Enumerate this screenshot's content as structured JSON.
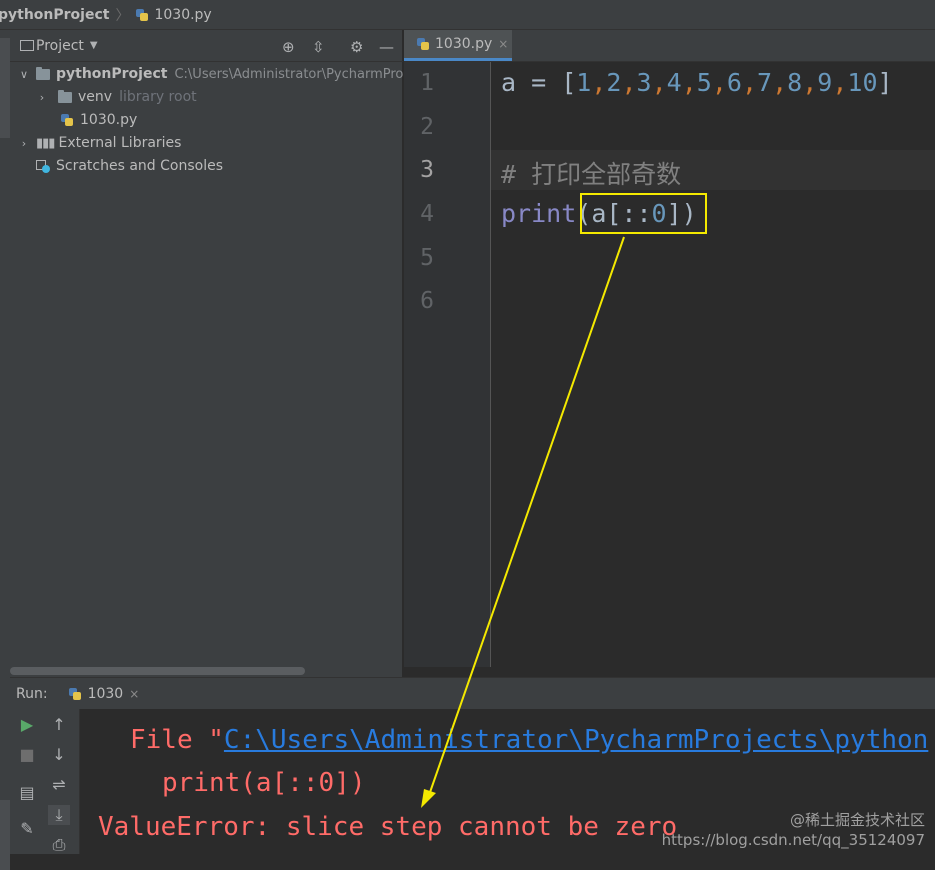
{
  "breadcrumb": {
    "project": "pythonProject",
    "file": "1030.py"
  },
  "project_panel": {
    "title": "Project",
    "tree": [
      {
        "label": "pythonProject",
        "extra": "C:\\Users\\Administrator\\PycharmPro"
      },
      {
        "label": "venv",
        "extra": "library root"
      },
      {
        "label": "1030.py"
      },
      {
        "label": "External Libraries"
      },
      {
        "label": "Scratches and Consoles"
      }
    ]
  },
  "editor": {
    "tab_label": "1030.py",
    "line_numbers": [
      "1",
      "2",
      "3",
      "4",
      "5",
      "6"
    ],
    "lines": {
      "l1_var": "a",
      "l1_op": " = [",
      "l1_nums": [
        "1",
        "2",
        "3",
        "4",
        "5",
        "6",
        "7",
        "8",
        "9",
        "10"
      ],
      "l1_close": "]",
      "l3_comment": "# 打印全部奇数",
      "l4_func": "print",
      "l4_args_open": "(a[::",
      "l4_num": "0",
      "l4_args_close": "])"
    }
  },
  "run_panel": {
    "label": "Run:",
    "tab_label": "1030",
    "console": {
      "file_prefix": "File \"",
      "file_link": "C:\\Users\\Administrator\\PycharmProjects\\python",
      "code_line": "print(a[::0])",
      "error": "ValueError: slice step cannot be zero"
    }
  },
  "watermark": {
    "line1": "@稀土掘金技术社区",
    "line2": "https://blog.csdn.net/qq_35124097"
  },
  "colors": {
    "highlight": "#f4e900",
    "error": "#ff6b68",
    "link": "#287bde"
  }
}
